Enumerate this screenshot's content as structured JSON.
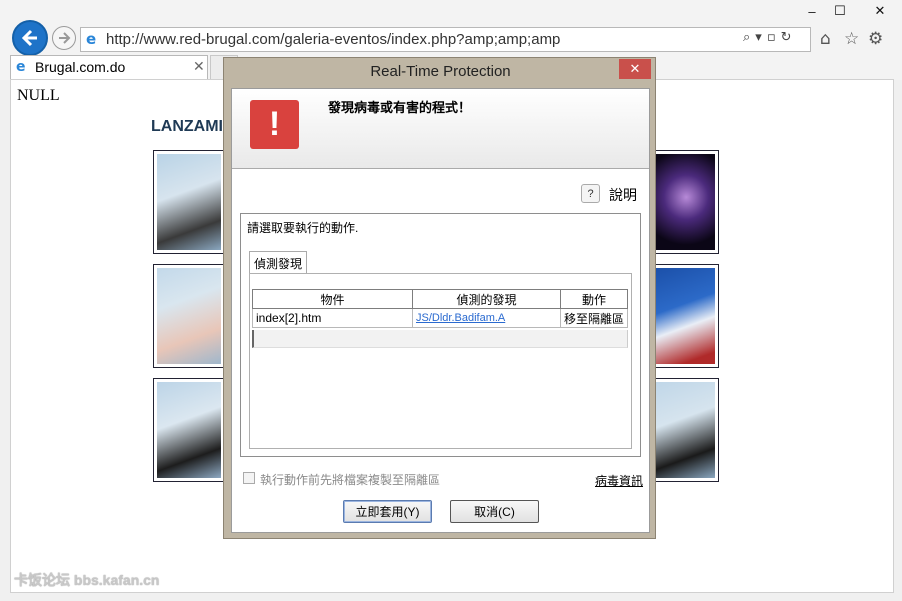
{
  "browser": {
    "url": "http://www.red-brugal.com/galeria-eventos/index.php?amp;amp;amp",
    "tab_title": "Brugal.com.do",
    "window_controls": {
      "minimize": "‒",
      "maximize": "☐",
      "close": "✕"
    },
    "icons": [
      "back-arrow-icon",
      "forward-arrow-icon",
      "ie-logo-icon",
      "search-icon",
      "refresh-icon",
      "home-icon",
      "favorites-star-icon",
      "gear-icon"
    ]
  },
  "page": {
    "null_text": "NULL",
    "heading_partial": "LANZAMI",
    "watermark": "卡饭论坛 bbs.kafan.cn"
  },
  "dialog": {
    "title": "Real-Time Protection",
    "close_symbol": "✕",
    "alert_title": "發現病毒或有害的程式！",
    "help_label": "說明",
    "help_symbol": "?",
    "choose_action": "請選取要執行的動作.",
    "tab_label": "偵測發現",
    "table": {
      "columns": [
        "物件",
        "偵測的發現",
        "動作"
      ],
      "rows": [
        {
          "object": "index[2].htm",
          "detection": "JS/Dldr.Badifam.A",
          "action": "移至隔離區"
        }
      ]
    },
    "copy_checkbox_label": "執行動作前先將檔案複製至隔離區",
    "copy_checkbox_checked": false,
    "virus_info_link": "病毒資訊",
    "apply_button": "立即套用(Y)",
    "cancel_button": "取消(C)",
    "colors": {
      "warning": "#d9423e",
      "link": "#2a6ad0",
      "close": "#c9504b"
    }
  }
}
